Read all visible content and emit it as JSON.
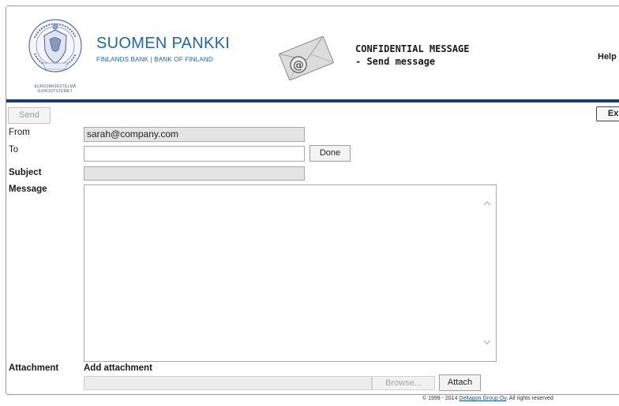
{
  "header": {
    "bank_name": "SUOMEN PANKKI",
    "bank_subtitle": "FINLANDS BANK | BANK OF FINLAND",
    "seal_caption": [
      "EUROJÄRJESTELMÄ",
      "EUROSYSTEMET"
    ],
    "message_title": "CONFIDENTIAL MESSAGE",
    "message_subtitle": "- Send message",
    "help_label": "Help",
    "bar_color": "#1e3d66",
    "brand_color": "#1f66b5",
    "seal_icon": "bank-of-finland-seal-icon",
    "envelope_icon": "envelope-at-icon"
  },
  "toolbar": {
    "send_label": "Send",
    "exit_label": "Exit"
  },
  "form": {
    "from_label": "From",
    "from_value": "sarah@company.com",
    "to_label": "To",
    "to_value": "",
    "done_label": "Done",
    "subject_label": "Subject",
    "subject_value": "",
    "message_label": "Message",
    "message_value": "",
    "attachment_label": "Attachment",
    "add_attachment_label": "Add attachment",
    "browse_label": "Browse...",
    "attach_label": "Attach"
  },
  "footer": {
    "copyright_prefix": "© 1999 - 2014",
    "company_link": "Deltagon Group Oy",
    "rights": ". All rights reserved"
  }
}
